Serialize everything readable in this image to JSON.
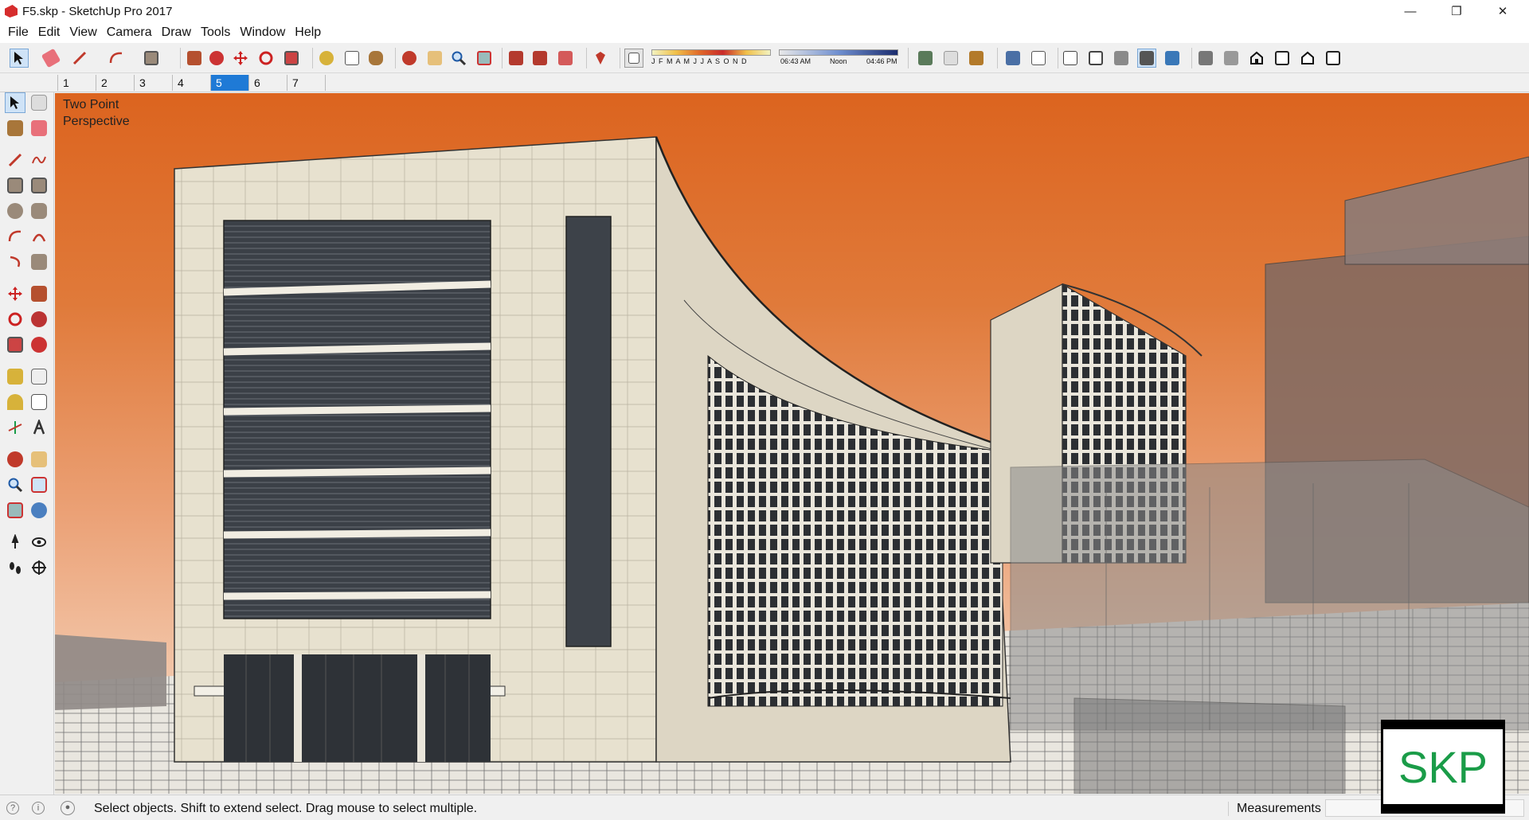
{
  "window": {
    "title": "F5.skp - SketchUp Pro 2017",
    "minimize_glyph": "—",
    "maximize_glyph": "❐",
    "close_glyph": "✕"
  },
  "menu": [
    "File",
    "Edit",
    "View",
    "Camera",
    "Draw",
    "Tools",
    "Window",
    "Help"
  ],
  "shadow_settings": {
    "months": "J F M A M J J A S O N D",
    "time_start": "06:43 AM",
    "time_mid": "Noon",
    "time_end": "04:46 PM"
  },
  "scene_tabs": [
    "1",
    "2",
    "3",
    "4",
    "5",
    "6",
    "7"
  ],
  "active_scene": "5",
  "viewport": {
    "camera_label_line1": "Two Point",
    "camera_label_line2": "Perspective",
    "sky_color": "#dc641f",
    "ground_color": "#f6d7c3"
  },
  "status": {
    "text": "Select objects. Shift to extend select. Drag mouse to select multiple.",
    "measurements_label": "Measurements",
    "measurements_value": ""
  },
  "watermark": "SKP",
  "colors": {
    "accent": "#1f7ad6",
    "skp_green": "#1a9c48",
    "brand_red": "#d62d2d"
  }
}
